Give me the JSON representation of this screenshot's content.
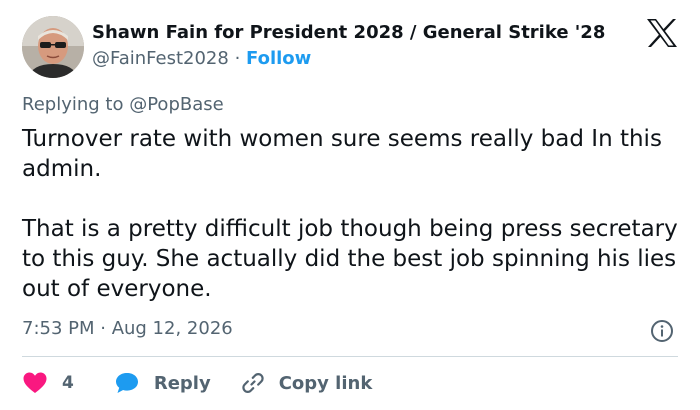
{
  "author": {
    "display_name": "Shawn Fain for President 2028 / General Strike '28",
    "handle": "@FainFest2028",
    "separator": "·",
    "follow_label": "Follow"
  },
  "platform_icon": "x-logo-icon",
  "reply_context": {
    "prefix": "Replying to",
    "mention": "@PopBase"
  },
  "tweet": {
    "paragraphs": [
      "Turnover rate with women sure seems really bad In this admin.",
      "That is a pretty difficult job though being press secretary to this guy. She actually did the best job spinning his lies out of everyone."
    ],
    "timestamp": "7:53 PM · Aug 12, 2026"
  },
  "actions": {
    "like_count": "4",
    "reply_label": "Reply",
    "copy_link_label": "Copy link"
  },
  "icons": {
    "like": "heart-icon",
    "reply": "reply-bubble-icon",
    "copy": "link-icon",
    "info": "info-icon"
  },
  "colors": {
    "text_primary": "#0f1419",
    "text_secondary": "#536471",
    "accent": "#1d9bf0",
    "like": "#f91880",
    "divider": "#cfd9de"
  }
}
